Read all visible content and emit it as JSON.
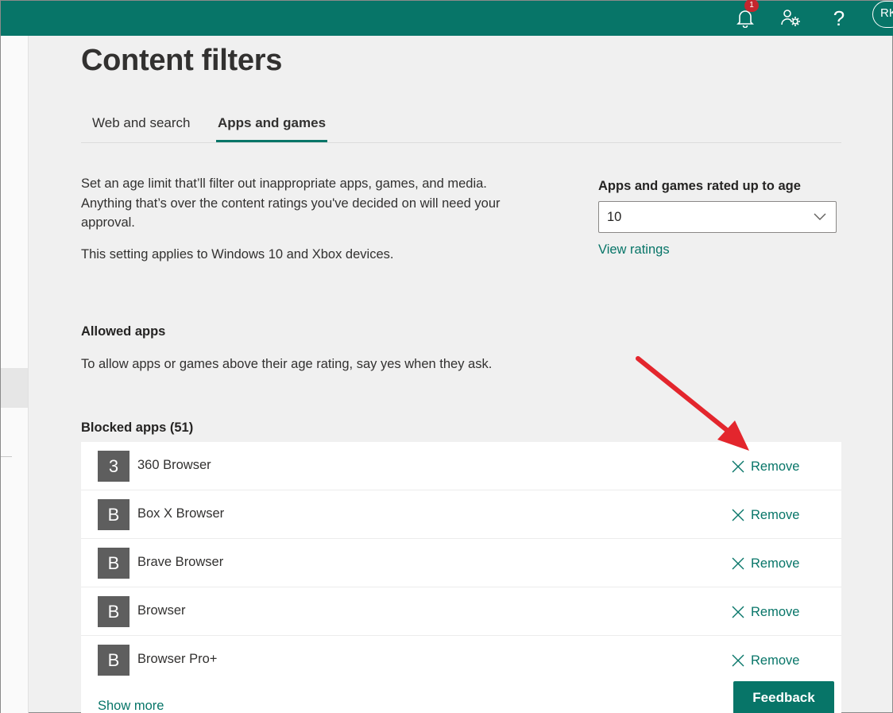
{
  "header": {
    "notification_count": "1",
    "avatar_initials": "RK",
    "help_glyph": "?",
    "icons": [
      "bell-icon",
      "people-settings-icon",
      "help-icon"
    ],
    "bar_color": "#077568"
  },
  "page": {
    "title": "Content filters"
  },
  "tabs": [
    {
      "label": "Web and search",
      "active": false
    },
    {
      "label": "Apps and games",
      "active": true
    }
  ],
  "apps_games": {
    "description": "Set an age limit that’ll filter out inappropriate apps, games, and media. Anything that’s over the content ratings you've decided on will need your approval.",
    "applies_note": "This setting applies to Windows 10 and Xbox devices.",
    "age_label": "Apps and games rated up to age",
    "age_value": "10",
    "view_ratings_label": "View ratings"
  },
  "allowed": {
    "heading": "Allowed apps",
    "description": "To allow apps or games above their age rating, say yes when they ask."
  },
  "blocked": {
    "heading": "Blocked apps (51)",
    "remove_label": "Remove",
    "items": [
      {
        "letter": "3",
        "name": "360 Browser"
      },
      {
        "letter": "B",
        "name": "Box X Browser"
      },
      {
        "letter": "B",
        "name": "Brave Browser"
      },
      {
        "letter": "B",
        "name": "Browser"
      },
      {
        "letter": "B",
        "name": "Browser Pro+"
      }
    ],
    "show_more_label": "Show more"
  },
  "feedback_label": "Feedback",
  "colors": {
    "accent": "#077568",
    "annotation_arrow": "#e3262d",
    "badge": "#c4262e"
  }
}
